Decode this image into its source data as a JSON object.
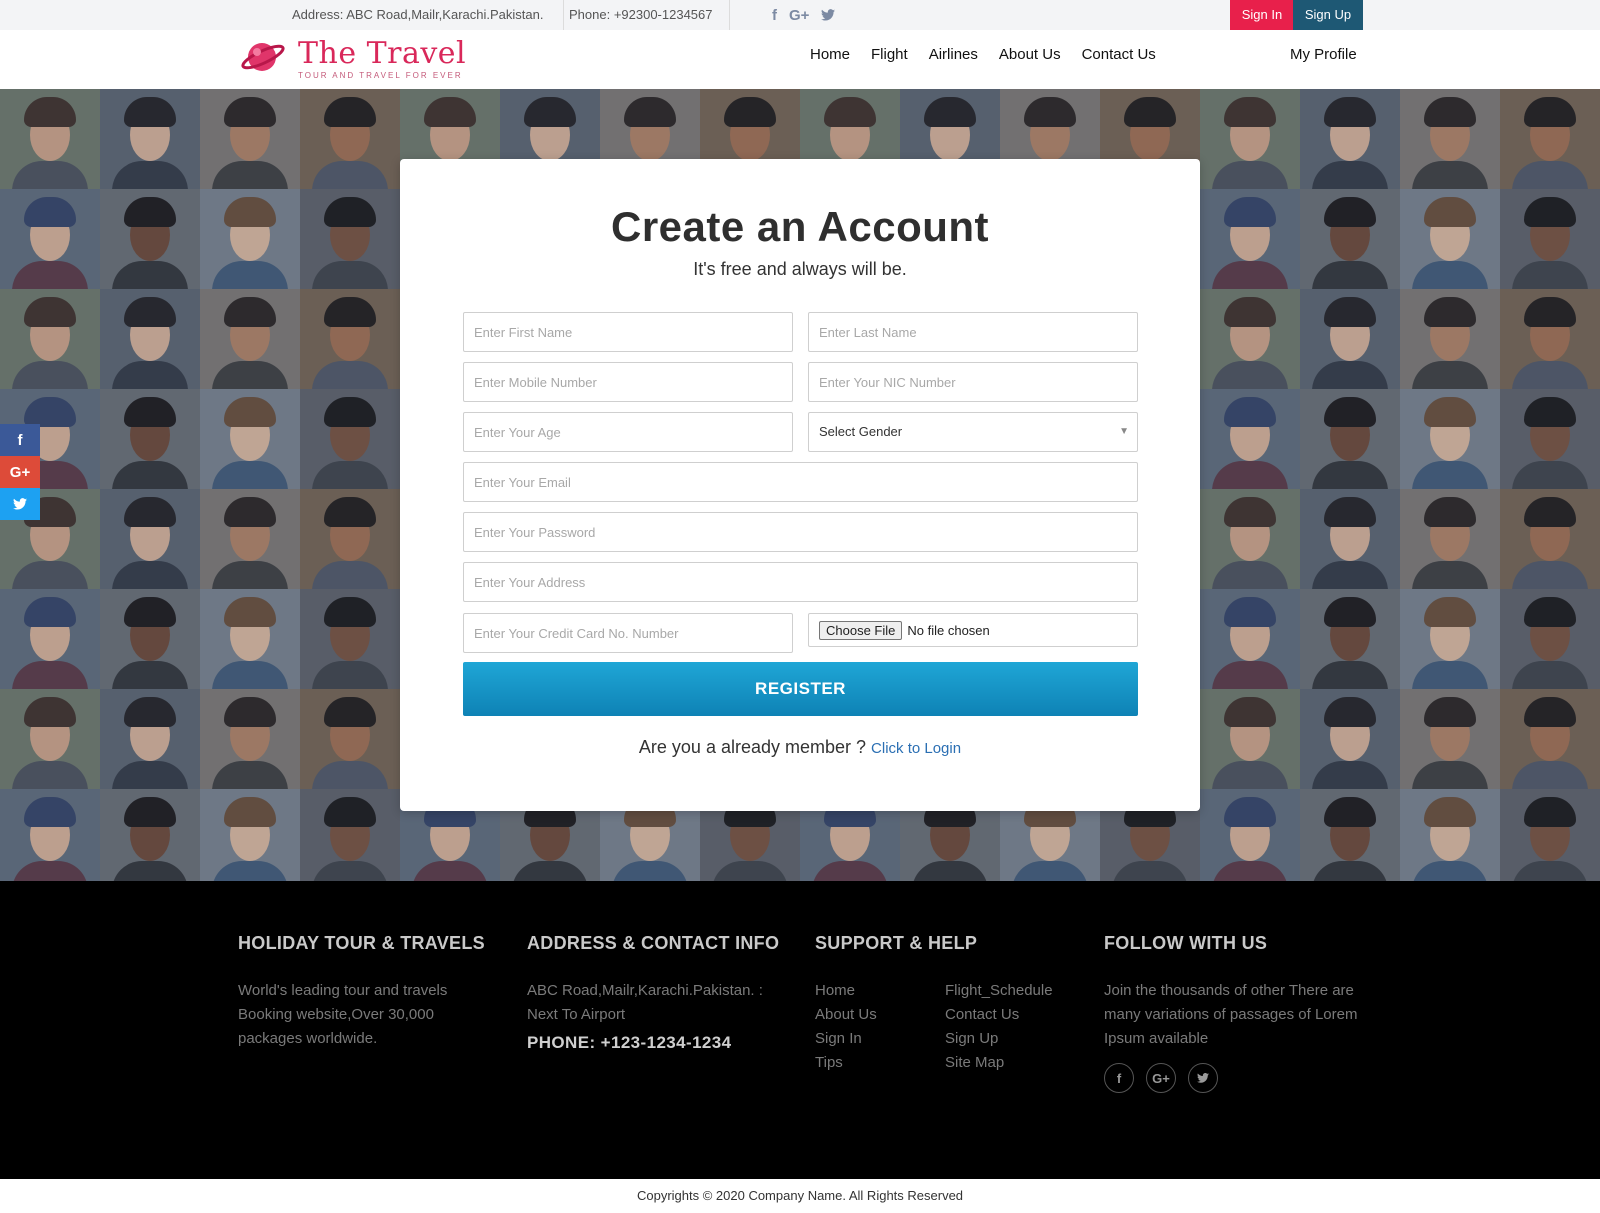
{
  "topbar": {
    "address": "Address: ABC Road,Mailr,Karachi.Pakistan.",
    "phone": "Phone: +92300-1234567",
    "signin_label": "Sign In",
    "signup_label": "Sign Up"
  },
  "header": {
    "brand_name": "The Travel",
    "brand_tagline": "TOUR AND TRAVEL FOR EVER",
    "nav": [
      "Home",
      "Flight",
      "Airlines",
      "About Us",
      "Contact Us"
    ],
    "profile_label": "My Profile"
  },
  "form": {
    "title": "Create an Account",
    "subtitle": "It's free and always will be.",
    "first_name_placeholder": "Enter First Name",
    "last_name_placeholder": "Enter Last Name",
    "mobile_placeholder": "Enter Mobile Number",
    "nic_placeholder": "Enter Your NIC Number",
    "age_placeholder": "Enter Your Age",
    "gender_selected": "Select Gender",
    "email_placeholder": "Enter Your Email",
    "password_placeholder": "Enter Your Password",
    "address_placeholder": "Enter Your Address",
    "credit_card_placeholder": "Enter Your Credit Card No. Number",
    "file_button": "Choose File",
    "file_status": "No file chosen",
    "register_label": "REGISTER",
    "already_text": "Are you a already member ?",
    "login_link": "Click to Login"
  },
  "footer": {
    "col1_title": "HOLIDAY TOUR & TRAVELS",
    "col1_text": "World's leading tour and travels Booking website,Over 30,000 packages worldwide.",
    "col2_title": "ADDRESS & CONTACT INFO",
    "col2_text": "ABC Road,Mailr,Karachi.Pakistan. : Next To Airport",
    "col2_phone": "PHONE: +123-1234-1234",
    "col3_title": "SUPPORT & HELP",
    "col3_links": [
      "Home",
      "Flight_Schedule",
      "About Us",
      "Contact Us",
      "Sign In",
      "Sign Up",
      "Tips",
      "Site Map"
    ],
    "col4_title": "FOLLOW WITH US",
    "col4_text": "Join the thousands of other There are many variations of passages of Lorem Ipsum available"
  },
  "copyright": "Copyrights © 2020 Company Name. All Rights Reserved",
  "colors": {
    "accent_red": "#e8204b",
    "accent_navy": "#1e5874",
    "register_blue": "#1a9ace",
    "brand_pink": "#d9285a"
  },
  "icons": {
    "social": [
      "facebook-icon",
      "google-plus-icon",
      "twitter-icon"
    ]
  }
}
